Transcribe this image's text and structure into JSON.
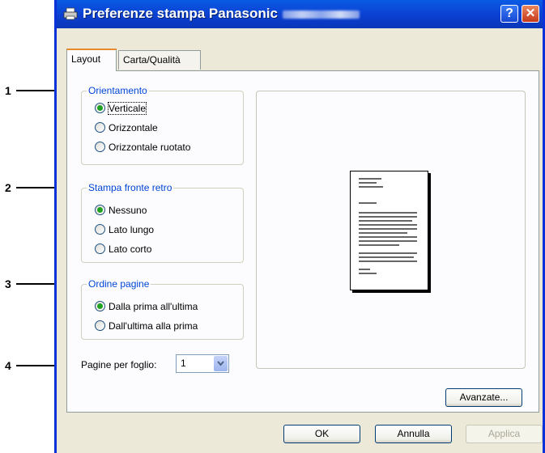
{
  "window": {
    "title": "Preferenze stampa Panasonic",
    "help_label": "?",
    "close_label": "✕"
  },
  "tabs": [
    {
      "label": "Layout",
      "active": true
    },
    {
      "label": "Carta/Qualità",
      "active": false
    }
  ],
  "orientation": {
    "legend": "Orientamento",
    "options": [
      {
        "label": "Verticale",
        "selected": true
      },
      {
        "label": "Orizzontale",
        "selected": false
      },
      {
        "label": "Orizzontale ruotato",
        "selected": false
      }
    ]
  },
  "duplex": {
    "legend": "Stampa fronte retro",
    "options": [
      {
        "label": "Nessuno",
        "selected": true
      },
      {
        "label": "Lato lungo",
        "selected": false
      },
      {
        "label": "Lato corto",
        "selected": false
      }
    ]
  },
  "page_order": {
    "legend": "Ordine pagine",
    "options": [
      {
        "label": "Dalla prima all'ultima",
        "selected": true
      },
      {
        "label": "Dall'ultima alla prima",
        "selected": false
      }
    ]
  },
  "pages_per_sheet": {
    "label": "Pagine per foglio:",
    "value": "1"
  },
  "buttons": {
    "advanced": "Avanzate...",
    "ok": "OK",
    "cancel": "Annulla",
    "apply": "Applica"
  },
  "callouts": [
    "1",
    "2",
    "3",
    "4"
  ],
  "colors": {
    "accent": "#0046d5",
    "titlebar": "#0b3fd1",
    "selected_radio": "#21a121"
  }
}
